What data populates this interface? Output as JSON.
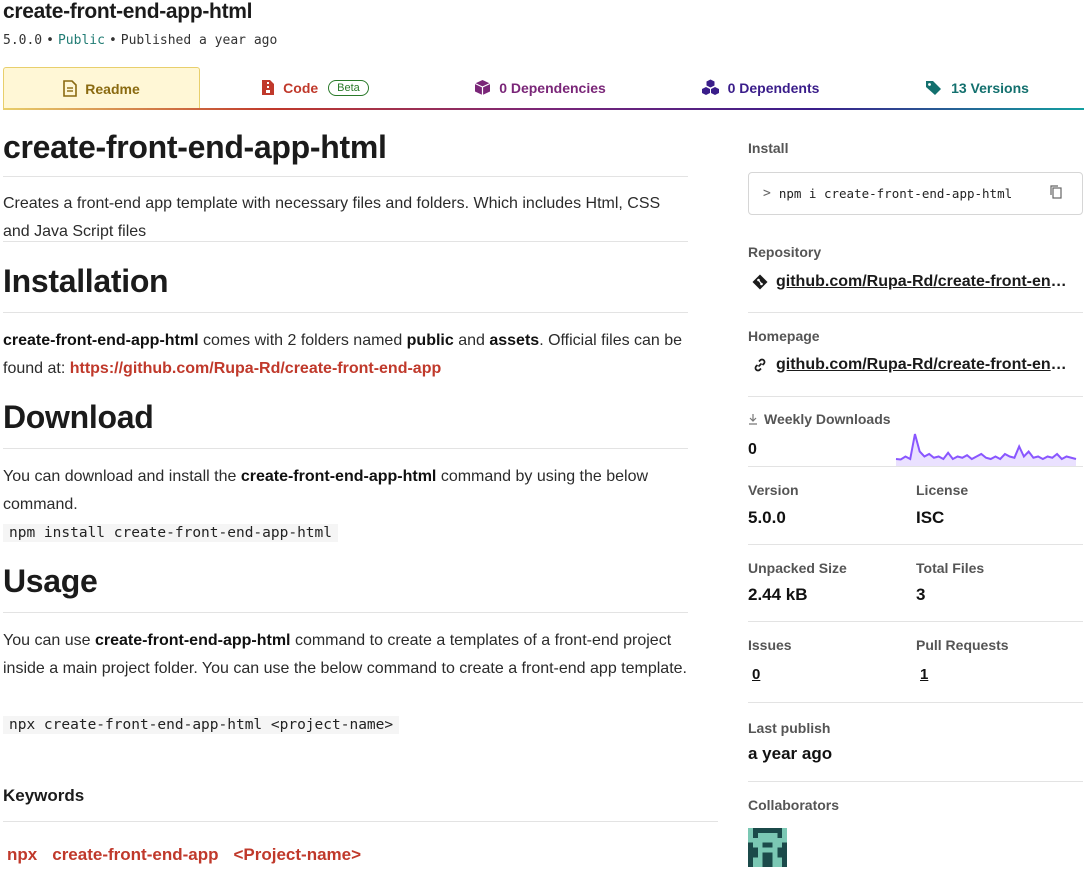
{
  "header": {
    "package_name": "create-front-end-app-html",
    "version": "5.0.0",
    "visibility": "Public",
    "published": "Published a year ago"
  },
  "tabs": [
    {
      "label": "Readme",
      "icon": "readme-doc-icon"
    },
    {
      "label": "Code",
      "badge": "Beta",
      "icon": "code-file-icon"
    },
    {
      "label": "0 Dependencies",
      "icon": "cube-icon"
    },
    {
      "label": "0 Dependents",
      "icon": "cubes-icon"
    },
    {
      "label": "13 Versions",
      "icon": "tags-icon"
    }
  ],
  "readme": {
    "title": "create-front-end-app-html",
    "intro": "Creates a front-end app template with necessary files and folders. Which includes Html, CSS and Java Script files",
    "installation": {
      "heading": "Installation",
      "p1_bold": "create-front-end-app-html",
      "p1_a": " comes with 2 folders named ",
      "p1_b1": "public",
      "p1_and": " and ",
      "p1_b2": "assets",
      "p1_c": ". Official files can be found at: ",
      "p1_link": "https://github.com/Rupa-Rd/create-front-end-app"
    },
    "download": {
      "heading": "Download",
      "p_a": "You can download and install the ",
      "p_bold": "create-front-end-app-html",
      "p_b": " command by using the below command.",
      "code": "npm install create-front-end-app-html"
    },
    "usage": {
      "heading": "Usage",
      "p_a": "You can use ",
      "p_bold": "create-front-end-app-html",
      "p_b": " command to create a templates of a front-end project inside a main project folder. You can use the below command to create a front-end app template.",
      "code": "npx create-front-end-app-html <project-name>"
    },
    "keywords_heading": "Keywords",
    "keywords": [
      "npx",
      "create-front-end-app",
      "<Project-name>"
    ]
  },
  "sidebar": {
    "install_label": "Install",
    "install_prompt": ">",
    "install_cmd": "npm i create-front-end-app-html",
    "repository_label": "Repository",
    "repository_text": "github.com/Rupa-Rd/create-front-end-...",
    "homepage_label": "Homepage",
    "homepage_text": "github.com/Rupa-Rd/create-front-end-...",
    "weekly_label": "Weekly Downloads",
    "weekly_value": "0",
    "sparkline": [
      2,
      1.8,
      3,
      2,
      12,
      5,
      3,
      4,
      2.5,
      3,
      2,
      4.5,
      2,
      3,
      2.5,
      3.5,
      2,
      3,
      4,
      2.5,
      2,
      3,
      2,
      4,
      3,
      2.5,
      7,
      3,
      5,
      2.5,
      3,
      2,
      3,
      2.5,
      4,
      2,
      3,
      2.5,
      2
    ],
    "accent": "#8956ff",
    "version_label": "Version",
    "version_value": "5.0.0",
    "license_label": "License",
    "license_value": "ISC",
    "size_label": "Unpacked Size",
    "size_value": "2.44 kB",
    "files_label": "Total Files",
    "files_value": "3",
    "issues_label": "Issues",
    "issues_value": "0",
    "prs_label": "Pull Requests",
    "prs_value": "1",
    "last_publish_label": "Last publish",
    "last_publish_value": "a year ago",
    "collaborators_label": "Collaborators"
  }
}
